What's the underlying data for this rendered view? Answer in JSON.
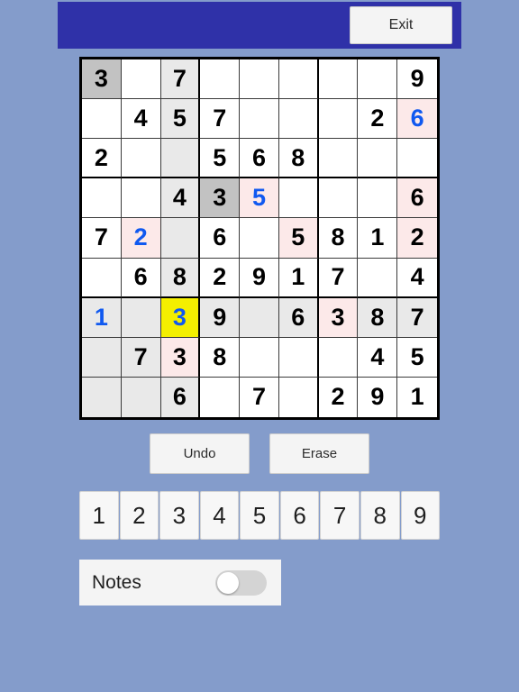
{
  "header": {
    "exit_label": "Exit",
    "bar_color": "#2f31a8"
  },
  "board": {
    "selected": {
      "row": 7,
      "col": 3
    },
    "colors": {
      "selected": "#f4ef00",
      "peer_highlight": "#e9e9e9",
      "same_number_highlight": "#c2c2c2",
      "conflict": "#fce9e9",
      "given_text": "#000000",
      "user_text": "#1059f0"
    },
    "cells": [
      [
        {
          "v": "3",
          "s": "same"
        },
        {
          "v": "",
          "s": ""
        },
        {
          "v": "7",
          "s": "peer"
        },
        {
          "v": "",
          "s": ""
        },
        {
          "v": "",
          "s": ""
        },
        {
          "v": "",
          "s": ""
        },
        {
          "v": "",
          "s": ""
        },
        {
          "v": "",
          "s": ""
        },
        {
          "v": "9",
          "s": ""
        }
      ],
      [
        {
          "v": "",
          "s": ""
        },
        {
          "v": "4",
          "s": ""
        },
        {
          "v": "5",
          "s": "peer"
        },
        {
          "v": "7",
          "s": ""
        },
        {
          "v": "",
          "s": ""
        },
        {
          "v": "",
          "s": ""
        },
        {
          "v": "",
          "s": ""
        },
        {
          "v": "2",
          "s": ""
        },
        {
          "v": "6",
          "s": "conflict",
          "u": true
        }
      ],
      [
        {
          "v": "2",
          "s": ""
        },
        {
          "v": "",
          "s": ""
        },
        {
          "v": "",
          "s": "peer"
        },
        {
          "v": "5",
          "s": ""
        },
        {
          "v": "6",
          "s": ""
        },
        {
          "v": "8",
          "s": ""
        },
        {
          "v": "",
          "s": ""
        },
        {
          "v": "",
          "s": ""
        },
        {
          "v": "",
          "s": ""
        }
      ],
      [
        {
          "v": "",
          "s": ""
        },
        {
          "v": "",
          "s": ""
        },
        {
          "v": "4",
          "s": "peer"
        },
        {
          "v": "3",
          "s": "same"
        },
        {
          "v": "5",
          "s": "conflict",
          "u": true
        },
        {
          "v": "",
          "s": ""
        },
        {
          "v": "",
          "s": ""
        },
        {
          "v": "",
          "s": ""
        },
        {
          "v": "6",
          "s": "conflict"
        }
      ],
      [
        {
          "v": "7",
          "s": ""
        },
        {
          "v": "2",
          "s": "conflict",
          "u": true
        },
        {
          "v": "",
          "s": "peer"
        },
        {
          "v": "6",
          "s": ""
        },
        {
          "v": "",
          "s": ""
        },
        {
          "v": "5",
          "s": "conflict"
        },
        {
          "v": "8",
          "s": ""
        },
        {
          "v": "1",
          "s": ""
        },
        {
          "v": "2",
          "s": "conflict"
        }
      ],
      [
        {
          "v": "",
          "s": ""
        },
        {
          "v": "6",
          "s": ""
        },
        {
          "v": "8",
          "s": "peer"
        },
        {
          "v": "2",
          "s": ""
        },
        {
          "v": "9",
          "s": ""
        },
        {
          "v": "1",
          "s": ""
        },
        {
          "v": "7",
          "s": ""
        },
        {
          "v": "",
          "s": ""
        },
        {
          "v": "4",
          "s": ""
        }
      ],
      [
        {
          "v": "1",
          "s": "peer",
          "u": true
        },
        {
          "v": "",
          "s": "peer"
        },
        {
          "v": "3",
          "s": "selected",
          "u": true
        },
        {
          "v": "9",
          "s": "peer"
        },
        {
          "v": "",
          "s": "peer"
        },
        {
          "v": "6",
          "s": "peer"
        },
        {
          "v": "3",
          "s": "conflict"
        },
        {
          "v": "8",
          "s": "peer"
        },
        {
          "v": "7",
          "s": "peer"
        }
      ],
      [
        {
          "v": "",
          "s": "peer"
        },
        {
          "v": "7",
          "s": "peer"
        },
        {
          "v": "3",
          "s": "conflict"
        },
        {
          "v": "8",
          "s": ""
        },
        {
          "v": "",
          "s": ""
        },
        {
          "v": "",
          "s": ""
        },
        {
          "v": "",
          "s": ""
        },
        {
          "v": "4",
          "s": ""
        },
        {
          "v": "5",
          "s": ""
        }
      ],
      [
        {
          "v": "",
          "s": "peer"
        },
        {
          "v": "",
          "s": "peer"
        },
        {
          "v": "6",
          "s": "peer"
        },
        {
          "v": "",
          "s": ""
        },
        {
          "v": "7",
          "s": ""
        },
        {
          "v": "",
          "s": ""
        },
        {
          "v": "2",
          "s": ""
        },
        {
          "v": "9",
          "s": ""
        },
        {
          "v": "1",
          "s": ""
        }
      ]
    ]
  },
  "actions": {
    "undo_label": "Undo",
    "erase_label": "Erase"
  },
  "number_pad": [
    "1",
    "2",
    "3",
    "4",
    "5",
    "6",
    "7",
    "8",
    "9"
  ],
  "notes": {
    "label": "Notes",
    "enabled": false
  }
}
